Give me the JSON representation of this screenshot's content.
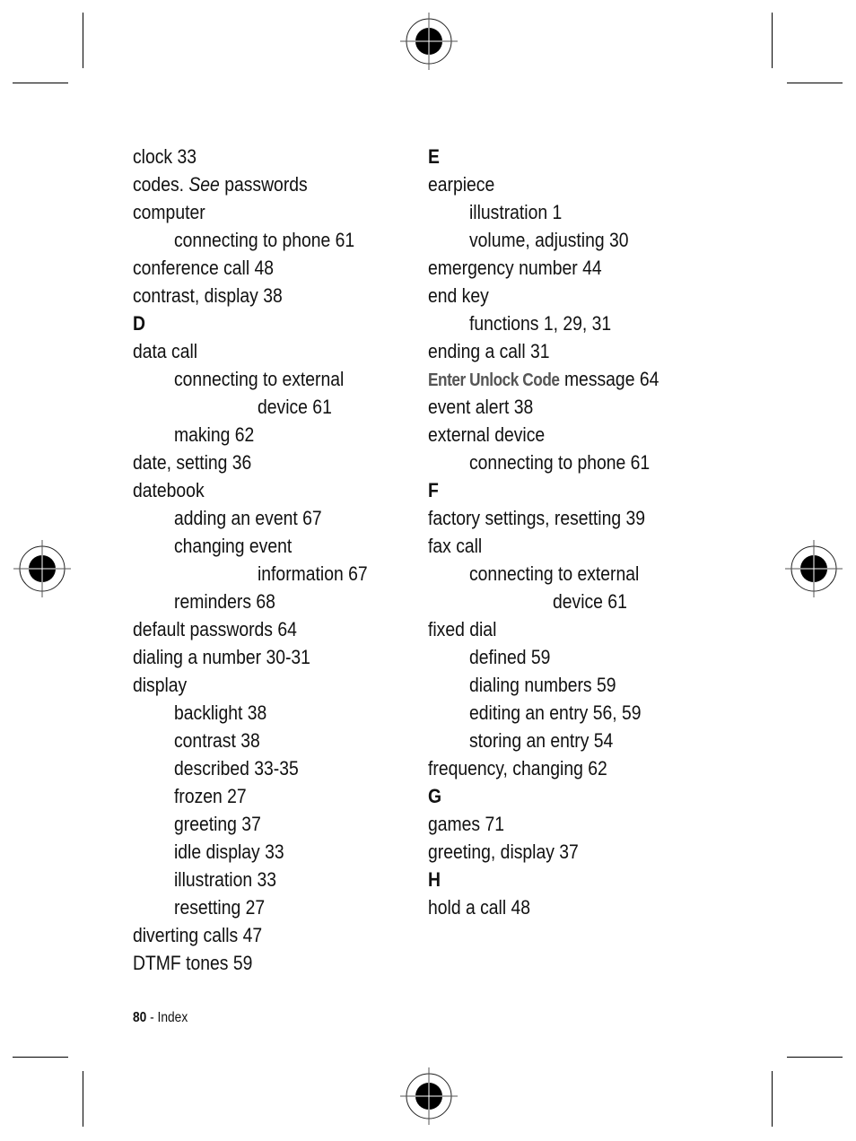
{
  "left_column": [
    {
      "level": 0,
      "text": "clock 33"
    },
    {
      "level": 0,
      "parts": [
        {
          "t": "codes. ",
          "s": "normal"
        },
        {
          "t": "See",
          "s": "italic"
        },
        {
          "t": " passwords",
          "s": "normal"
        }
      ]
    },
    {
      "level": 0,
      "text": "computer"
    },
    {
      "level": 1,
      "text": "connecting to phone 61"
    },
    {
      "level": 0,
      "text": "conference call 48"
    },
    {
      "level": 0,
      "text": "contrast, display 38"
    },
    {
      "level": "letter",
      "text": "D"
    },
    {
      "level": 0,
      "text": "data call"
    },
    {
      "level": 1,
      "text": "connecting to external"
    },
    {
      "level": 2,
      "text": "device 61"
    },
    {
      "level": 1,
      "text": "making 62"
    },
    {
      "level": 0,
      "text": "date, setting 36"
    },
    {
      "level": 0,
      "text": "datebook"
    },
    {
      "level": 1,
      "text": "adding an event 67"
    },
    {
      "level": 1,
      "text": "changing event"
    },
    {
      "level": 2,
      "text": "information 67"
    },
    {
      "level": 1,
      "text": "reminders 68"
    },
    {
      "level": 0,
      "text": "default passwords 64"
    },
    {
      "level": 0,
      "text": "dialing a number 30-31"
    },
    {
      "level": 0,
      "text": "display"
    },
    {
      "level": 1,
      "text": "backlight 38"
    },
    {
      "level": 1,
      "text": "contrast 38"
    },
    {
      "level": 1,
      "text": "described 33-35"
    },
    {
      "level": 1,
      "text": "frozen 27"
    },
    {
      "level": 1,
      "text": "greeting 37"
    },
    {
      "level": 1,
      "text": "idle display 33"
    },
    {
      "level": 1,
      "text": "illustration 33"
    },
    {
      "level": 1,
      "text": "resetting 27"
    },
    {
      "level": 0,
      "text": "diverting calls 47"
    },
    {
      "level": 0,
      "text": "DTMF tones 59"
    }
  ],
  "right_column": [
    {
      "level": "letter",
      "text": "E"
    },
    {
      "level": 0,
      "text": "earpiece"
    },
    {
      "level": 1,
      "text": "illustration 1"
    },
    {
      "level": 1,
      "text": "volume, adjusting 30"
    },
    {
      "level": 0,
      "text": "emergency number 44"
    },
    {
      "level": 0,
      "text": "end key"
    },
    {
      "level": 1,
      "text": "functions 1, 29, 31"
    },
    {
      "level": 0,
      "text": "ending a call 31"
    },
    {
      "level": 0,
      "parts": [
        {
          "t": "Enter Unlock Code",
          "s": "ui"
        },
        {
          "t": " message 64",
          "s": "normal"
        }
      ]
    },
    {
      "level": 0,
      "text": "event alert 38"
    },
    {
      "level": 0,
      "text": "external device"
    },
    {
      "level": 1,
      "text": "connecting to phone 61"
    },
    {
      "level": "letter",
      "text": "F"
    },
    {
      "level": 0,
      "text": "factory settings, resetting 39"
    },
    {
      "level": 0,
      "text": "fax call"
    },
    {
      "level": 1,
      "text": "connecting to external"
    },
    {
      "level": 2,
      "text": "device 61"
    },
    {
      "level": 0,
      "text": "fixed dial"
    },
    {
      "level": 1,
      "text": "defined 59"
    },
    {
      "level": 1,
      "text": "dialing numbers 59"
    },
    {
      "level": 1,
      "text": "editing an entry 56, 59"
    },
    {
      "level": 1,
      "text": "storing an entry 54"
    },
    {
      "level": 0,
      "text": "frequency, changing 62"
    },
    {
      "level": "letter",
      "text": "G"
    },
    {
      "level": 0,
      "text": "games 71"
    },
    {
      "level": 0,
      "text": "greeting, display 37"
    },
    {
      "level": "letter",
      "text": "H"
    },
    {
      "level": 0,
      "text": "hold a call 48"
    }
  ],
  "footer": {
    "page_number": "80",
    "separator": " - ",
    "section": "Index"
  }
}
